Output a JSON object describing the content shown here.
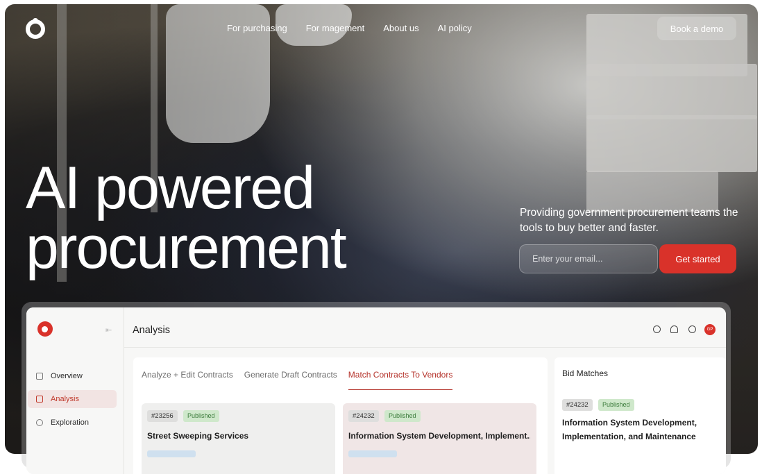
{
  "nav": {
    "links": [
      "For purchasing",
      "For magement",
      "About us",
      "AI policy"
    ],
    "demo_label": "Book a demo"
  },
  "hero": {
    "title_line1": "AI powered",
    "title_line2": "procurement",
    "subtitle": "Providing government procurement teams the tools to buy better and faster.",
    "email_placeholder": "Enter your email...",
    "cta_label": "Get started"
  },
  "app": {
    "sidebar": {
      "items": [
        {
          "label": "Overview",
          "icon": "grid-icon"
        },
        {
          "label": "Analysis",
          "icon": "document-icon"
        },
        {
          "label": "Exploration",
          "icon": "search-icon"
        }
      ],
      "active": "Analysis"
    },
    "header": {
      "title": "Analysis",
      "avatar_initials": "GP"
    },
    "tabs": [
      "Analyze + Edit Contracts",
      "Generate Draft Contracts",
      "Match Contracts To Vendors"
    ],
    "active_tab": "Match Contracts To Vendors",
    "cards": [
      {
        "id": "#23256",
        "status": "Published",
        "title": "Street Sweeping Services"
      },
      {
        "id": "#24232",
        "status": "Published",
        "title": "Information System Development, Implement..."
      }
    ],
    "bids": {
      "title": "Bid Matches",
      "card": {
        "id": "#24232",
        "status": "Published",
        "title": "Information System Development, Implementation, and Maintenance"
      }
    }
  },
  "colors": {
    "accent": "#d9322a",
    "published_bg": "#cfe8cb",
    "active_tab": "#b5332b"
  }
}
